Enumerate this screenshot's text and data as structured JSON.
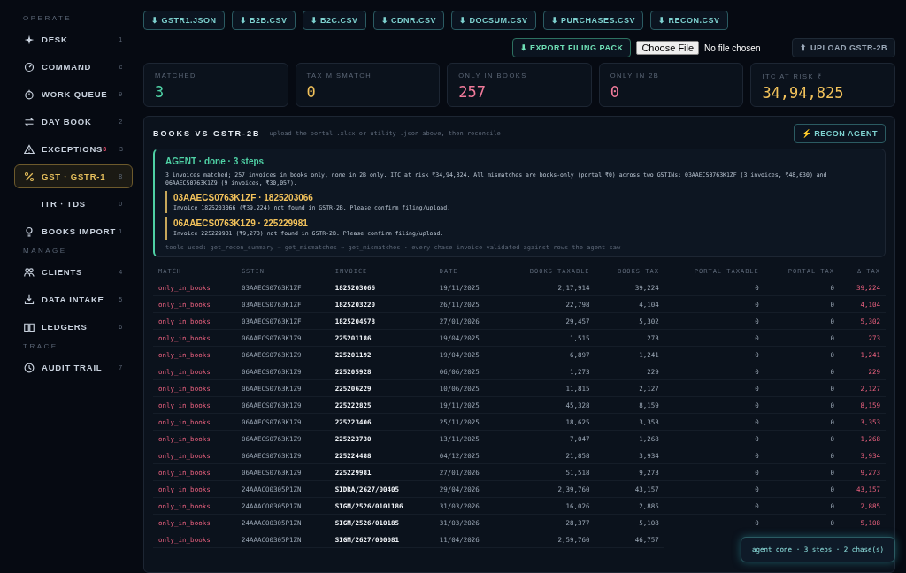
{
  "sidebar": {
    "sections": [
      {
        "title": "OPERATE",
        "items": [
          {
            "label": "DESK",
            "key": "1",
            "selected": false
          },
          {
            "label": "COMMAND",
            "key": "c",
            "selected": false
          },
          {
            "label": "WORK QUEUE",
            "key": "9",
            "selected": false
          },
          {
            "label": "DAY BOOK",
            "key": "2",
            "selected": false
          },
          {
            "label": "EXCEPTIONS",
            "badge": "3",
            "key": "3",
            "selected": false
          },
          {
            "label": "GST · GSTR-1",
            "key": "8",
            "selected": true
          },
          {
            "label": "ITR · TDS",
            "key": "0",
            "selected": false
          },
          {
            "label": "BOOKS IMPORT",
            "key": "1",
            "selected": false
          }
        ]
      },
      {
        "title": "MANAGE",
        "items": [
          {
            "label": "CLIENTS",
            "key": "4",
            "selected": false
          },
          {
            "label": "DATA INTAKE",
            "key": "5",
            "selected": false
          },
          {
            "label": "LEDGERS",
            "key": "6",
            "selected": false
          }
        ]
      },
      {
        "title": "TRACE",
        "items": [
          {
            "label": "AUDIT TRAIL",
            "key": "7",
            "selected": false
          }
        ]
      }
    ]
  },
  "downloads": [
    "⬇ GSTR1.JSON",
    "⬇ B2B.CSV",
    "⬇ B2C.CSV",
    "⬇ CDNR.CSV",
    "⬇ DOCSUM.CSV",
    "⬇ PURCHASES.CSV",
    "⬇ RECON.CSV"
  ],
  "actions": {
    "export": "⬇ EXPORT FILING PACK",
    "choose_file": "Choose File",
    "file_status": "No file chosen",
    "upload": "⬆ UPLOAD GSTR-2B"
  },
  "stats": [
    {
      "label": "MATCHED",
      "value": "3",
      "color": "#4fd1a5"
    },
    {
      "label": "TAX MISMATCH",
      "value": "0",
      "color": "#f2c25b"
    },
    {
      "label": "ONLY IN BOOKS",
      "value": "257",
      "color": "#f07a9a"
    },
    {
      "label": "ONLY IN 2B",
      "value": "0",
      "color": "#f07a9a"
    },
    {
      "label": "ITC AT RISK ₹",
      "value": "34,94,825",
      "color": "#f2c25b"
    }
  ],
  "panel": {
    "title": "BOOKS VS GSTR-2B",
    "hint": "upload the portal .xlsx or utility .json above, then reconcile",
    "agent_button": "⚡ RECON AGENT",
    "agent": {
      "heading": "AGENT · done · 3 steps",
      "summary": "3 invoices matched; 257 invoices in books only, none in 2B only. ITC at risk ₹34,94,824. All mismatches are books-only (portal ₹0) across two GSTINs: 03AAECS0763K1ZF (3 invoices, ₹48,630) and 06AAECS0763K1Z9 (9 invoices, ₹30,057).",
      "chases": [
        {
          "title": "03AAECS0763K1ZF · 1825203066",
          "text": "Invoice 1825203066 (₹39,224) not found in GSTR-2B. Please confirm filing/upload."
        },
        {
          "title": "06AAECS0763K1Z9 · 225229981",
          "text": "Invoice 225229981 (₹9,273) not found in GSTR-2B. Please confirm filing/upload."
        }
      ],
      "tools": "tools used: get_recon_summary → get_mismatches → get_mismatches · every chase invoice validated against rows the agent saw"
    },
    "table": {
      "columns": [
        "MATCH",
        "GSTIN",
        "INVOICE",
        "DATE",
        "BOOKS TAXABLE",
        "BOOKS TAX",
        "PORTAL TAXABLE",
        "PORTAL TAX",
        "Δ TAX"
      ],
      "rows": [
        [
          "only_in_books",
          "03AAECS0763K1ZF",
          "1825203066",
          "19/11/2025",
          "2,17,914",
          "39,224",
          "0",
          "0",
          "39,224"
        ],
        [
          "only_in_books",
          "03AAECS0763K1ZF",
          "1825203220",
          "26/11/2025",
          "22,798",
          "4,104",
          "0",
          "0",
          "4,104"
        ],
        [
          "only_in_books",
          "03AAECS0763K1ZF",
          "1825204578",
          "27/01/2026",
          "29,457",
          "5,302",
          "0",
          "0",
          "5,302"
        ],
        [
          "only_in_books",
          "06AAECS0763K1Z9",
          "225201186",
          "19/04/2025",
          "1,515",
          "273",
          "0",
          "0",
          "273"
        ],
        [
          "only_in_books",
          "06AAECS0763K1Z9",
          "225201192",
          "19/04/2025",
          "6,897",
          "1,241",
          "0",
          "0",
          "1,241"
        ],
        [
          "only_in_books",
          "06AAECS0763K1Z9",
          "225205928",
          "06/06/2025",
          "1,273",
          "229",
          "0",
          "0",
          "229"
        ],
        [
          "only_in_books",
          "06AAECS0763K1Z9",
          "225206229",
          "10/06/2025",
          "11,815",
          "2,127",
          "0",
          "0",
          "2,127"
        ],
        [
          "only_in_books",
          "06AAECS0763K1Z9",
          "225222825",
          "19/11/2025",
          "45,328",
          "8,159",
          "0",
          "0",
          "8,159"
        ],
        [
          "only_in_books",
          "06AAECS0763K1Z9",
          "225223406",
          "25/11/2025",
          "18,625",
          "3,353",
          "0",
          "0",
          "3,353"
        ],
        [
          "only_in_books",
          "06AAECS0763K1Z9",
          "225223730",
          "13/11/2025",
          "7,047",
          "1,268",
          "0",
          "0",
          "1,268"
        ],
        [
          "only_in_books",
          "06AAECS0763K1Z9",
          "225224488",
          "04/12/2025",
          "21,858",
          "3,934",
          "0",
          "0",
          "3,934"
        ],
        [
          "only_in_books",
          "06AAECS0763K1Z9",
          "225229981",
          "27/01/2026",
          "51,518",
          "9,273",
          "0",
          "0",
          "9,273"
        ],
        [
          "only_in_books",
          "24AAACO0305P1ZN",
          "SIDRA/2627/00405",
          "29/04/2026",
          "2,39,760",
          "43,157",
          "0",
          "0",
          "43,157"
        ],
        [
          "only_in_books",
          "24AAACO0305P1ZN",
          "SIGM/2526/0101186",
          "31/03/2026",
          "16,026",
          "2,885",
          "0",
          "0",
          "2,885"
        ],
        [
          "only_in_books",
          "24AAACO0305P1ZN",
          "SIGM/2526/010185",
          "31/03/2026",
          "28,377",
          "5,108",
          "0",
          "0",
          "5,108"
        ],
        [
          "only_in_books",
          "24AAACO0305P1ZN",
          "SIGM/2627/000081",
          "11/04/2026",
          "2,59,760",
          "46,757"
        ]
      ]
    }
  },
  "toast": "agent done · 3 steps · 2 chase(s)"
}
